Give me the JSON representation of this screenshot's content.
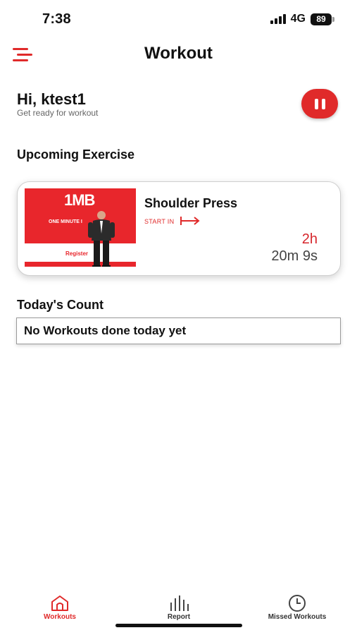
{
  "status": {
    "time": "7:38",
    "network": "4G",
    "battery": "89"
  },
  "header": {
    "title": "Workout",
    "menu_icon": "hamburger-menu-icon"
  },
  "greeting": {
    "title": "Hi, ktest1",
    "subtitle": "Get ready for workout",
    "pause_icon": "pause-icon"
  },
  "upcoming": {
    "section_title": "Upcoming Exercise",
    "exercise": {
      "name": "Shoulder Press",
      "start_label": "START IN",
      "countdown_hours": "2h",
      "countdown_rest": "20m 9s",
      "thumbnail": {
        "logo": "1MB",
        "tagline": "ONE MINUTE I",
        "register": "Register"
      }
    }
  },
  "today": {
    "section_title": "Today's Count",
    "message": "No Workouts done today yet"
  },
  "tabs": [
    {
      "label": "Workouts",
      "icon": "home-icon",
      "active": true
    },
    {
      "label": "Report",
      "icon": "bar-chart-icon",
      "active": false
    },
    {
      "label": "Missed Workouts",
      "icon": "clock-icon",
      "active": false
    }
  ],
  "colors": {
    "accent": "#e02a2a",
    "text": "#111111",
    "muted": "#666666"
  }
}
